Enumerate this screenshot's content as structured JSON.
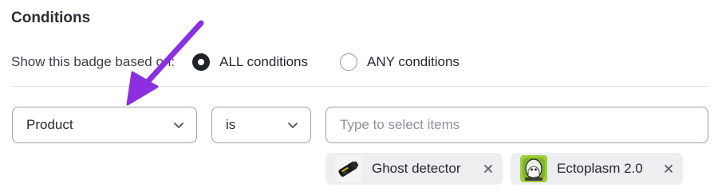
{
  "section": {
    "title": "Conditions"
  },
  "basis": {
    "label": "Show this badge based on:",
    "options": [
      {
        "label": "ALL conditions",
        "selected": true
      },
      {
        "label": "ANY conditions",
        "selected": false
      }
    ]
  },
  "condition": {
    "field": {
      "value": "Product",
      "icon": "chevron-down-icon"
    },
    "operator": {
      "value": "is",
      "icon": "chevron-down-icon"
    },
    "items_input": {
      "placeholder": "Type to select items",
      "value": ""
    },
    "selected_items": [
      {
        "label": "Ghost detector",
        "thumbnail": "ghost-detector-thumbnail",
        "remove_icon": "close-icon"
      },
      {
        "label": "Ectoplasm 2.0",
        "thumbnail": "ectoplasm-thumbnail",
        "remove_icon": "close-icon"
      }
    ]
  },
  "annotation": {
    "arrow_color": "#8b2fe0"
  },
  "colors": {
    "border": "#9aa1a9",
    "tag_background": "#eceef0",
    "radio_checked": "#1f2328"
  }
}
